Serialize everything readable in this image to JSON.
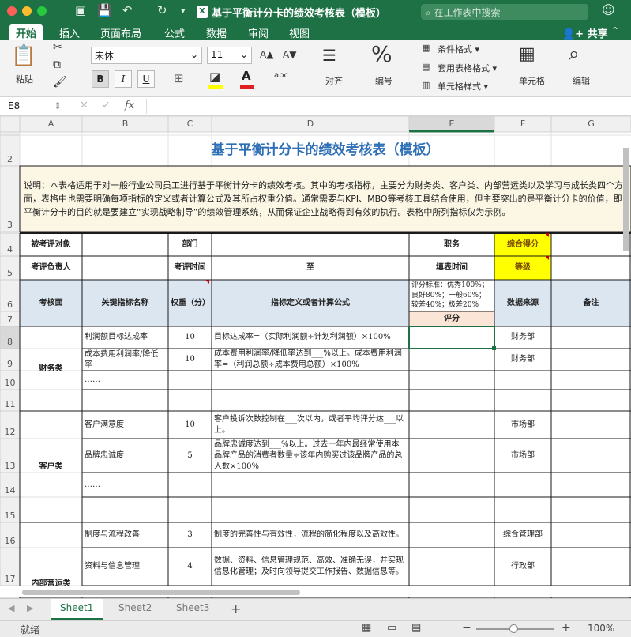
{
  "window": {
    "title": "基于平衡计分卡的绩效考核表（模板）",
    "search_placeholder": "在工作表中搜索"
  },
  "ribbon_tabs": [
    "开始",
    "插入",
    "页面布局",
    "公式",
    "数据",
    "审阅",
    "视图"
  ],
  "share_label": "共享",
  "ribbon": {
    "paste": "粘贴",
    "font_name": "宋体",
    "font_size": "11",
    "grow_font": "A▲",
    "shrink_font": "A▼",
    "bold": "B",
    "italic": "I",
    "underline": "U",
    "align": "对齐",
    "number": "编号",
    "conditional_format": "条件格式 ▾",
    "table_format": "套用表格格式 ▾",
    "cell_style": "单元格样式 ▾",
    "cells": "单元格",
    "edit": "编辑"
  },
  "formula_bar": {
    "name_box": "E8",
    "fx": "fx",
    "formula": ""
  },
  "columns": [
    "A",
    "B",
    "C",
    "D",
    "E",
    "F",
    "G"
  ],
  "rows": [
    "",
    "2",
    "3",
    "4",
    "5",
    "6",
    "7",
    "8",
    "9",
    "10",
    "11",
    "12",
    "13",
    "14",
    "15",
    "16",
    "17",
    ""
  ],
  "sheet": {
    "title": "基于平衡计分卡的绩效考核表（模板）",
    "description": "说明：本表格适用于对一般行业公司员工进行基于平衡计分卡的绩效考核。其中的考核指标，主要分为财务类、客户类、内部营运类以及学习与成长类四个方面，表格中也需要明确每项指标的定义或者计算公式及其所占权重分值。通常需要与KPI、MBO等考核工具结合使用，但主要突出的是平衡计分卡的价值，即平衡计分卡的目的就是要建立“实现战略制导”的绩效管理系统，从而保证企业战略得到有效的执行。表格中所列指标仅为示例。",
    "info": {
      "appraisee": "被考评对象",
      "dept": "部门",
      "position": "职务",
      "total_score": "综合得分",
      "appraiser": "考评负责人",
      "period": "考评时间",
      "to": "至",
      "fill_time": "填表时间",
      "grade": "等级"
    },
    "headers": {
      "aspect": "考核面",
      "kpi": "关键指标名称",
      "weight": "权重（分）",
      "definition": "指标定义或者计算公式",
      "criteria": "评分标准：优秀100%；良好80%；一般60%；较差40%；极差20%",
      "score": "评分",
      "source": "数据来源",
      "note": "备注"
    },
    "sections": [
      {
        "name": "财务类",
        "items": [
          {
            "kpi": "利润额目标达成率",
            "weight": "10",
            "definition": "目标达成率=（实际利润额÷计划利润额）×100%",
            "source": "财务部"
          },
          {
            "kpi": "成本费用利润率/降低率",
            "weight": "10",
            "definition": "成本费用利润率/降低率达到___%以上。成本费用利润率=（利润总额÷成本费用总额）×100%",
            "source": "财务部"
          },
          {
            "kpi": "……",
            "weight": "",
            "definition": "",
            "source": ""
          },
          {
            "kpi": "",
            "weight": "",
            "definition": "",
            "source": ""
          }
        ]
      },
      {
        "name": "客户类",
        "items": [
          {
            "kpi": "客户满意度",
            "weight": "10",
            "definition": "客户投诉次数控制在___次以内，或者平均评分达___以上。",
            "source": "市场部"
          },
          {
            "kpi": "品牌忠诚度",
            "weight": "5",
            "definition": "品牌忠诚度达到___%以上。过去一年内最经常使用本品牌产品的消费者数量÷该年内购买过该品牌产品的总人数×100%",
            "source": "市场部"
          },
          {
            "kpi": "……",
            "weight": "",
            "definition": "",
            "source": ""
          },
          {
            "kpi": "",
            "weight": "",
            "definition": "",
            "source": ""
          }
        ]
      },
      {
        "name": "内部营运类",
        "items": [
          {
            "kpi": "制度与流程改善",
            "weight": "3",
            "definition": "制度的完善性与有效性，流程的简化程度以及高效性。",
            "source": "综合管理部"
          },
          {
            "kpi": "资料与信息管理",
            "weight": "4",
            "definition": "数据、资料、信息管理规范、高效、准确无误，并实现信息化管理；及时向领导提交工作报告、数据信息等。",
            "source": "行政部"
          },
          {
            "kpi": "……",
            "weight": "",
            "definition": "",
            "source": ""
          }
        ]
      }
    ]
  },
  "sheet_tabs": [
    "Sheet1",
    "Sheet2",
    "Sheet3"
  ],
  "status": {
    "ready": "就绪",
    "zoom": "100%"
  },
  "colors": {
    "excel_green": "#1e7145",
    "title_blue": "#2e6fb5",
    "header_fill": "#dce6f1",
    "yellow": "#ffff00",
    "criteria_fill": "#fbe5d6"
  }
}
